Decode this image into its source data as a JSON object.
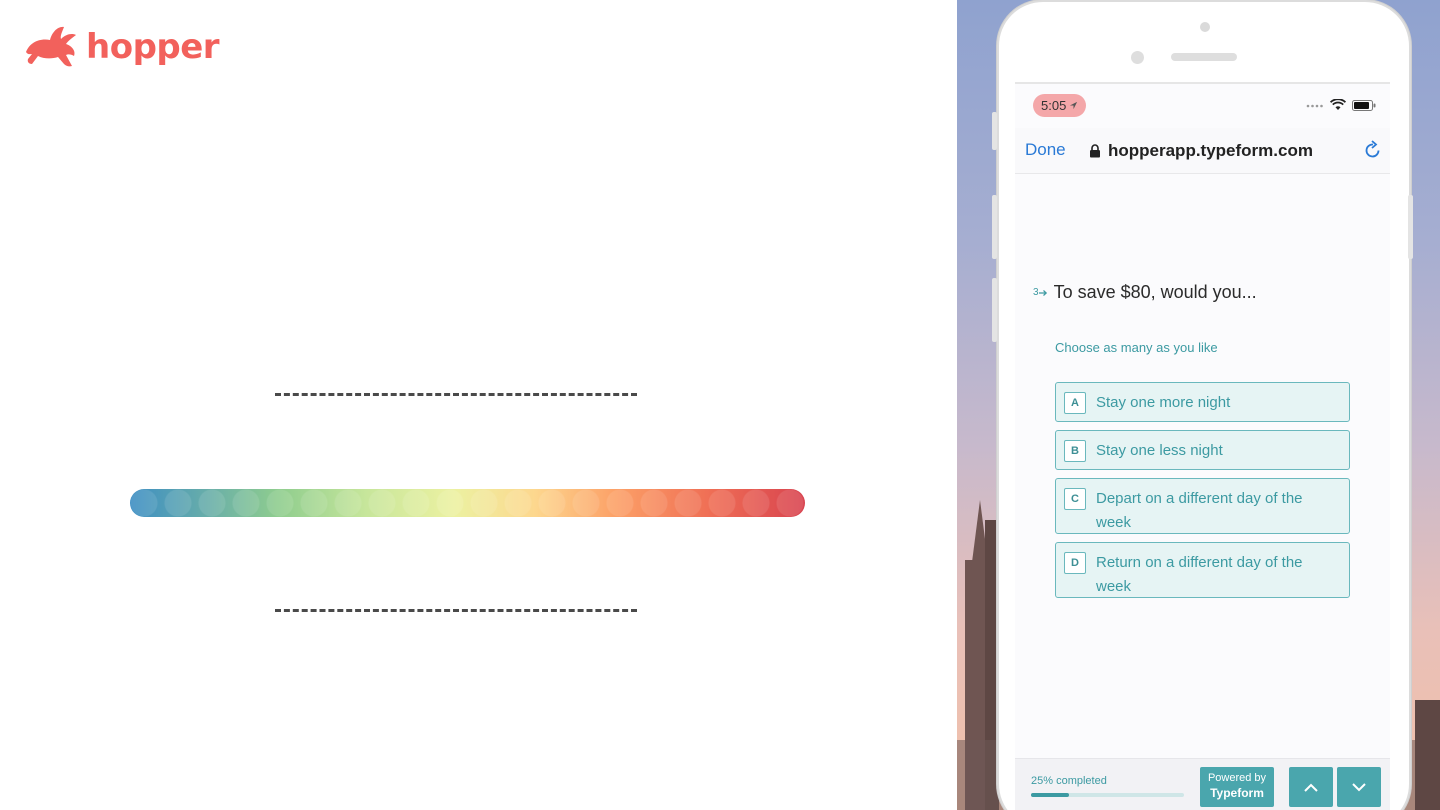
{
  "brand": {
    "name": "hopper",
    "color": "#f2615c",
    "logo_icon": "rabbit-icon"
  },
  "colors": {
    "accent": "#3c9aa2",
    "choice_bg": "#e6f4f4",
    "link": "#2a7ad6",
    "gradient": [
      "#3d8ec3",
      "#8fcd8e",
      "#ecf1a1",
      "#fca067",
      "#d8434f"
    ]
  },
  "phone": {
    "status_bar": {
      "time": "5:05",
      "icons": [
        "location-arrow-icon",
        "signal-dots-icon",
        "wifi-icon",
        "battery-icon"
      ]
    },
    "browser": {
      "done_label": "Done",
      "url": "hopperapp.typeform.com",
      "lock_icon": "lock-icon",
      "reload_icon": "reload-icon"
    },
    "form": {
      "question_number": "3",
      "question_text": "To save $80, would you...",
      "hint": "Choose as many as you like",
      "choices": [
        {
          "key": "A",
          "label": "Stay one more night"
        },
        {
          "key": "B",
          "label": "Stay one less night"
        },
        {
          "key": "C",
          "label": "Depart on a different day of the week"
        },
        {
          "key": "D",
          "label": "Return on a different day of the week"
        }
      ]
    },
    "footer": {
      "progress_label": "25% completed",
      "progress_percent": 25,
      "powered_line1": "Powered by",
      "powered_line2": "Typeform",
      "up_icon": "chevron-up-icon",
      "down_icon": "chevron-down-icon"
    }
  }
}
